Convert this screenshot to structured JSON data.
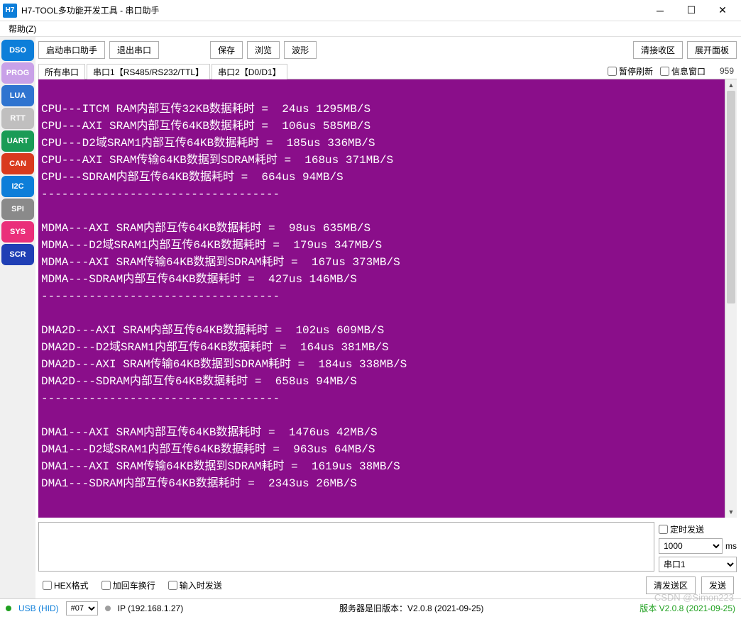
{
  "window": {
    "icon_text": "H7",
    "title": "H7-TOOL多功能开发工具 - 串口助手"
  },
  "menu": {
    "help": "帮助(Z)"
  },
  "sidebar": {
    "items": [
      {
        "label": "DSO",
        "color": "#0d7ed9"
      },
      {
        "label": "PROG",
        "color": "#c9a1e8"
      },
      {
        "label": "LUA",
        "color": "#2f74d0"
      },
      {
        "label": "RTT",
        "color": "#c0bfbf"
      },
      {
        "label": "UART",
        "color": "#1a9b56"
      },
      {
        "label": "CAN",
        "color": "#d93a1e"
      },
      {
        "label": "I2C",
        "color": "#0d7ed9"
      },
      {
        "label": "SPI",
        "color": "#8a8a8a"
      },
      {
        "label": "SYS",
        "color": "#ea2f7a"
      },
      {
        "label": "SCR",
        "color": "#1f3fb5"
      }
    ]
  },
  "toolbar": {
    "start": "启动串口助手",
    "exit": "退出串口",
    "save": "保存",
    "browse": "浏览",
    "wave": "波形",
    "clear_recv": "清接收区",
    "expand": "展开面板"
  },
  "tabs": {
    "all": "所有串口",
    "port1": "串口1【RS485/RS232/TTL】",
    "port2": "串口2【D0/D1】",
    "pause": "暂停刷新",
    "info": "信息窗口",
    "count": "959"
  },
  "terminal_text": "CPU---ITCM RAM内部互传32KB数据耗时 =  24us 1295MB/S\nCPU---AXI SRAM内部互传64KB数据耗时 =  106us 585MB/S\nCPU---D2域SRAM1内部互传64KB数据耗时 =  185us 336MB/S\nCPU---AXI SRAM传输64KB数据到SDRAM耗时 =  168us 371MB/S\nCPU---SDRAM内部互传64KB数据耗时 =  664us 94MB/S\n-----------------------------------\n\nMDMA---AXI SRAM内部互传64KB数据耗时 =  98us 635MB/S\nMDMA---D2域SRAM1内部互传64KB数据耗时 =  179us 347MB/S\nMDMA---AXI SRAM传输64KB数据到SDRAM耗时 =  167us 373MB/S\nMDMA---SDRAM内部互传64KB数据耗时 =  427us 146MB/S\n-----------------------------------\n\nDMA2D---AXI SRAM内部互传64KB数据耗时 =  102us 609MB/S\nDMA2D---D2域SRAM1内部互传64KB数据耗时 =  164us 381MB/S\nDMA2D---AXI SRAM传输64KB数据到SDRAM耗时 =  184us 338MB/S\nDMA2D---SDRAM内部互传64KB数据耗时 =  658us 94MB/S\n-----------------------------------\n\nDMA1---AXI SRAM内部互传64KB数据耗时 =  1476us 42MB/S\nDMA1---D2域SRAM1内部互传64KB数据耗时 =  963us 64MB/S\nDMA1---AXI SRAM传输64KB数据到SDRAM耗时 =  1619us 38MB/S\nDMA1---SDRAM内部互传64KB数据耗时 =  2343us 26MB/S",
  "send": {
    "timed_send": "定时发送",
    "interval": "1000",
    "unit": "ms",
    "port": "串口1",
    "hex": "HEX格式",
    "crlf": "加回车换行",
    "echo": "输入时发送",
    "clear_send": "清发送区",
    "send_btn": "发送"
  },
  "status": {
    "usb": "USB (HID)",
    "sel": "#07",
    "ip": "IP (192.168.1.27)",
    "server": "服务器是旧版本：V2.0.8 (2021-09-25)",
    "version": "版本 V2.0.8 (2021-09-25)"
  },
  "watermark": "CSDN @Simon223"
}
